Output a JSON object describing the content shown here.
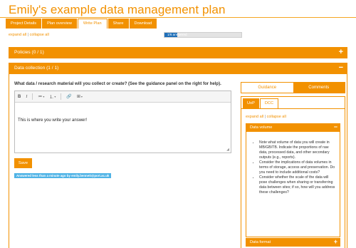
{
  "page": {
    "title": "Emily's example data management plan"
  },
  "tabs": [
    {
      "label": "Project Details",
      "active": false
    },
    {
      "label": "Plan overview",
      "active": false
    },
    {
      "label": "Write Plan",
      "active": true
    },
    {
      "label": "Share",
      "active": false
    },
    {
      "label": "Download",
      "active": false
    }
  ],
  "expand_controls": {
    "expand_label": "expand all",
    "separator": "|",
    "collapse_label": "collapse all"
  },
  "progress": {
    "label": "1/6 answered",
    "answered": 1,
    "total": 6
  },
  "sections": [
    {
      "title": "Policies (0 / 1)",
      "toggle": "+"
    },
    {
      "title": "Data collection (1 / 1)",
      "toggle": "−"
    }
  ],
  "question": {
    "text": "What data / research material will you collect or create? (See the guidance panel on the right for help).",
    "answer": "This is where you write your answer!"
  },
  "toolbar": {
    "bold": "B",
    "italic": "I",
    "bullet_list": "≔",
    "numbered_list": "⒈",
    "link": "🔗",
    "table": "⊞",
    "caret": "▾"
  },
  "save_button": {
    "label": "Save"
  },
  "answered_badge": {
    "text": "Answered less than a minute ago by emily.bennett@port.ac.uk"
  },
  "guidance_tabs": [
    {
      "label": "Guidance",
      "active": true
    },
    {
      "label": "Comments",
      "active": false
    }
  ],
  "guidance_subtabs": [
    {
      "label": "UoP",
      "active": false
    },
    {
      "label": "DCC",
      "active": true
    }
  ],
  "guidance_expand": {
    "expand_label": "expand all",
    "separator": "|",
    "collapse_label": "collapse all"
  },
  "guidance_accordions": [
    {
      "title": "Data volume",
      "toggle": "−",
      "items": [
        "Note what volume of data you will create in MB/GB/TB. Indicate the proportions of raw data, processed data, and other secondary outputs (e.g., reports).",
        "Consider the implications of data volumes in terms of storage, access and preservation. Do you need to include additional costs?",
        "Consider whether the scale of the data will pose challenges when sharing or transferring data between sites; if so, how will you address these challenges?"
      ]
    },
    {
      "title": "Data format",
      "toggle": "+"
    }
  ],
  "colors": {
    "accent": "#f29100",
    "progress": "#1f6fb8",
    "badge": "#4fb3e6"
  }
}
